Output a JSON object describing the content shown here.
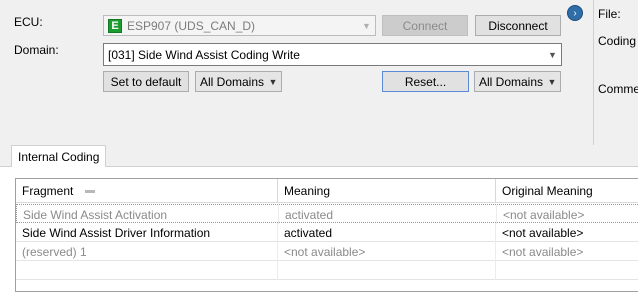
{
  "ecu": {
    "label": "ECU:",
    "badge": "E",
    "selected": "ESP907 (UDS_CAN_D)",
    "connect_label": "Connect",
    "disconnect_label": "Disconnect"
  },
  "domain": {
    "label": "Domain:",
    "selected": "[031] Side Wind Assist Coding Write",
    "set_default_label": "Set to default",
    "filter_left": "All Domains",
    "reset_label": "Reset...",
    "filter_right": "All Domains"
  },
  "right_panel": {
    "file_label": "File:",
    "coding_label": "Coding S",
    "comment_label": "Commer"
  },
  "tabs": [
    {
      "label": "Internal Coding"
    }
  ],
  "grid": {
    "columns": [
      "Fragment",
      "Meaning",
      "Original Meaning"
    ],
    "rows": [
      {
        "fragment": "Side Wind Assist Activation",
        "meaning": "activated",
        "original": "<not available>"
      },
      {
        "fragment": "Side Wind Assist Driver Information",
        "meaning": "activated",
        "original": "<not available>"
      },
      {
        "fragment": "(reserved) 1",
        "meaning": "<not available>",
        "original": "<not available>"
      }
    ]
  }
}
